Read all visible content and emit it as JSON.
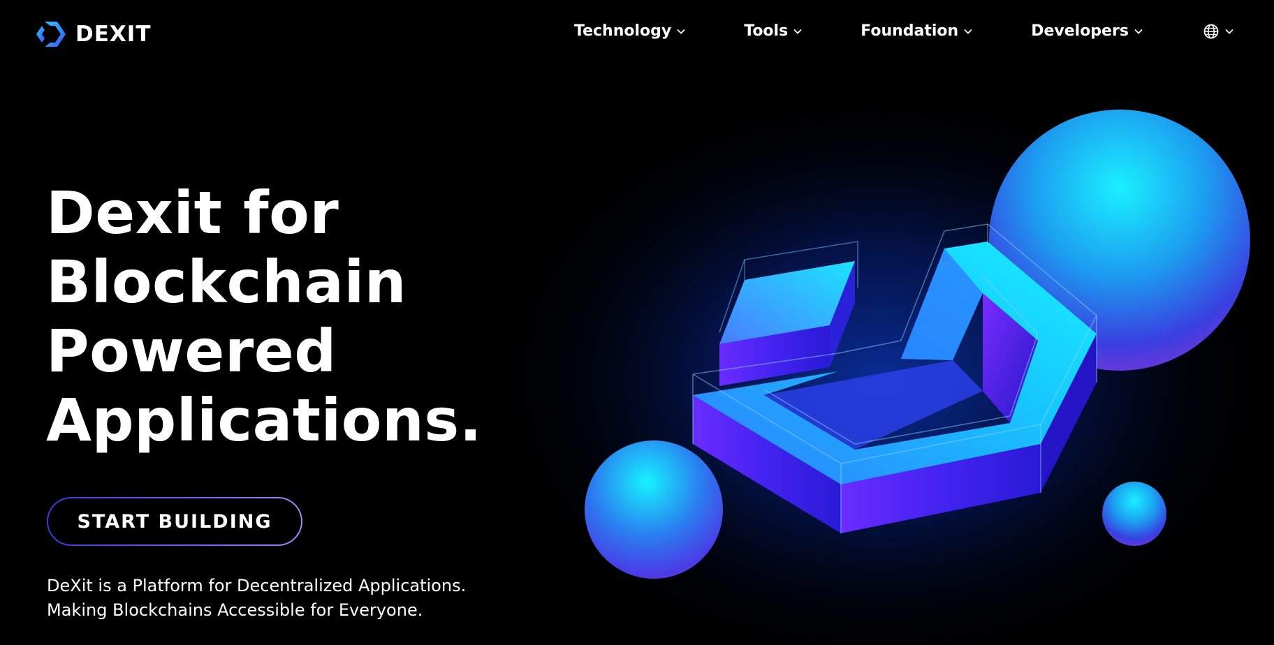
{
  "brand": {
    "name": "DEXIT",
    "accent": "#2f6bff"
  },
  "nav": {
    "items": [
      {
        "label": "Technology"
      },
      {
        "label": "Tools"
      },
      {
        "label": "Foundation"
      },
      {
        "label": "Developers"
      }
    ],
    "language_icon": "globe-icon",
    "dropdown_icon": "chevron-down-icon"
  },
  "hero": {
    "title_lines": [
      "Dexit for",
      "Blockchain",
      "Powered",
      "Applications."
    ],
    "cta_label": "START BUILDING",
    "tagline_lines": [
      "DeXit is a Platform for Decentralized Applications.",
      "Making Blockchains Accessible for Everyone."
    ]
  },
  "colors": {
    "background": "#000000",
    "text": "#ffffff",
    "cyan": "#19e6ff",
    "violet": "#5b2cff",
    "button_border": "#7a5cf5"
  }
}
